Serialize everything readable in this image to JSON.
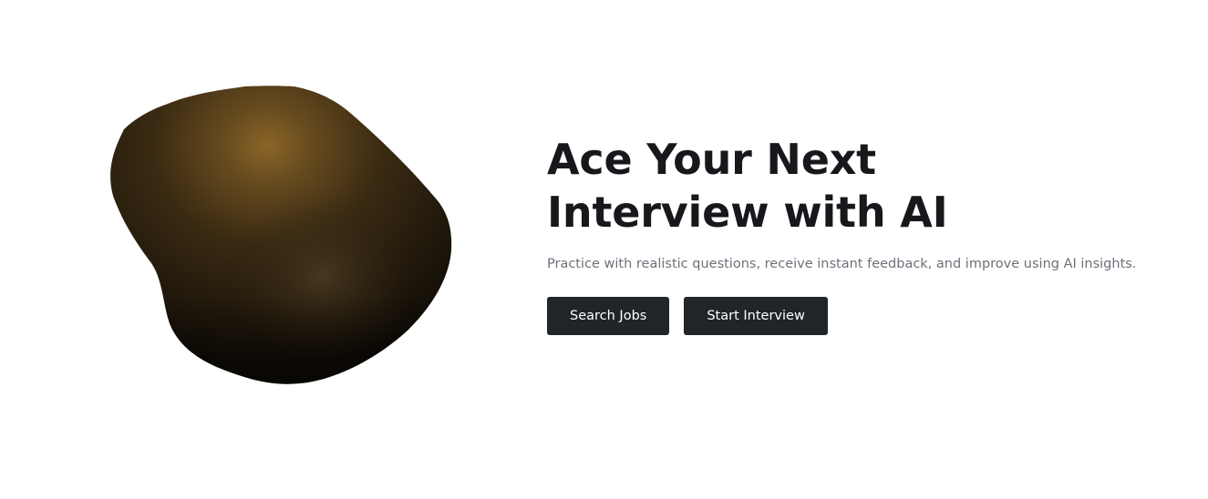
{
  "hero": {
    "headline": "Ace Your Next Interview with AI",
    "subtitle": "Practice with realistic questions, receive instant feedback, and improve using AI insights.",
    "buttons": {
      "search_jobs": "Search Jobs",
      "start_interview": "Start Interview"
    }
  },
  "colors": {
    "background": "#ffffff",
    "headline": "#16181c",
    "subtitle": "#6b717a",
    "button_bg": "#212429",
    "button_text": "#ffffff",
    "blob_highlight": "#8a6426",
    "blob_dark": "#181208"
  }
}
